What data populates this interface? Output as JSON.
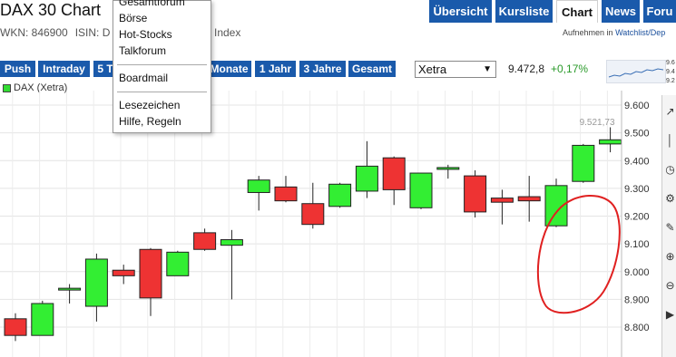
{
  "header": {
    "title": "DAX 30 Chart",
    "wkn_label": "WKN: 846900",
    "isin_label": "ISIN: D",
    "index_label": "Index"
  },
  "nav": {
    "tabs": [
      "Übersicht",
      "Kursliste",
      "Chart",
      "News",
      "Foru"
    ],
    "active": "Chart"
  },
  "watchlist": {
    "prefix": "Aufnehmen in",
    "link": "Watchlist/Dep"
  },
  "periods": [
    "Push",
    "Intraday",
    "5 T",
    "Monate",
    "1 Jahr",
    "3 Jahre",
    "Gesamt"
  ],
  "exchange": {
    "selected": "Xetra"
  },
  "quote": {
    "price": "9.472,8",
    "change": "+0,17%"
  },
  "minichart": {
    "labels": [
      "9.6",
      "9.4",
      "9.2"
    ]
  },
  "dropdown": {
    "items": [
      "Gesamtforum",
      "Börse",
      "Hot-Stocks",
      "Talkforum",
      "Boardmail",
      "Lesezeichen",
      "Hilfe, Regeln"
    ]
  },
  "colors": {
    "up": "#33ee33",
    "down": "#ee3333",
    "nav": "#1a5aab",
    "annotation": "#e02020"
  },
  "chart_data": {
    "type": "candlestick",
    "legend": "DAX (Xetra)",
    "last_label": "9.521,73",
    "y_ticks": [
      "9.600",
      "9.500",
      "9.400",
      "9.300",
      "9.200",
      "9.100",
      "9.000",
      "8.900",
      "8.800"
    ],
    "ylim": [
      8.76,
      9.62
    ],
    "candles": [
      {
        "o": 8.83,
        "h": 8.85,
        "l": 8.75,
        "c": 8.77
      },
      {
        "o": 8.77,
        "h": 8.895,
        "l": 8.77,
        "c": 8.885
      },
      {
        "o": 8.94,
        "h": 8.955,
        "l": 8.885,
        "c": 8.94
      },
      {
        "o": 8.875,
        "h": 9.065,
        "l": 8.82,
        "c": 9.045
      },
      {
        "o": 9.005,
        "h": 9.025,
        "l": 8.955,
        "c": 8.985
      },
      {
        "o": 9.08,
        "h": 9.085,
        "l": 8.84,
        "c": 8.905
      },
      {
        "o": 8.985,
        "h": 9.075,
        "l": 8.985,
        "c": 9.07
      },
      {
        "o": 9.14,
        "h": 9.155,
        "l": 9.075,
        "c": 9.08
      },
      {
        "o": 9.095,
        "h": 9.15,
        "l": 8.9,
        "c": 9.115
      },
      {
        "o": 9.285,
        "h": 9.345,
        "l": 9.22,
        "c": 9.33
      },
      {
        "o": 9.305,
        "h": 9.345,
        "l": 9.25,
        "c": 9.255
      },
      {
        "o": 9.245,
        "h": 9.32,
        "l": 9.155,
        "c": 9.17
      },
      {
        "o": 9.235,
        "h": 9.32,
        "l": 9.23,
        "c": 9.315
      },
      {
        "o": 9.29,
        "h": 9.47,
        "l": 9.265,
        "c": 9.38
      },
      {
        "o": 9.41,
        "h": 9.415,
        "l": 9.24,
        "c": 9.295
      },
      {
        "o": 9.23,
        "h": 9.355,
        "l": 9.225,
        "c": 9.355
      },
      {
        "o": 9.375,
        "h": 9.385,
        "l": 9.335,
        "c": 9.375
      },
      {
        "o": 9.345,
        "h": 9.365,
        "l": 9.195,
        "c": 9.215
      },
      {
        "o": 9.265,
        "h": 9.295,
        "l": 9.17,
        "c": 9.25
      },
      {
        "o": 9.27,
        "h": 9.345,
        "l": 9.18,
        "c": 9.255
      },
      {
        "o": 9.165,
        "h": 9.335,
        "l": 9.16,
        "c": 9.31
      },
      {
        "o": 9.325,
        "h": 9.46,
        "l": 9.32,
        "c": 9.455
      },
      {
        "o": 9.46,
        "h": 9.52,
        "l": 9.43,
        "c": 9.475
      }
    ]
  }
}
